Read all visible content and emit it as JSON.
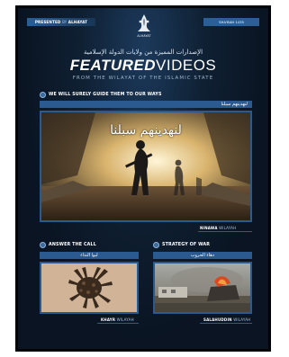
{
  "header": {
    "presented_prefix": "PRESENTED",
    "presented_by": "BY",
    "presented_brand": "ALHAYAT",
    "date": "SHA'BAN 1435",
    "logo_text": "ALHAYAT",
    "arabic_title": "الإصدارات المميزة من ولايات الدولة الإسلامية",
    "title_bold": "FEATURED",
    "title_light": "VIDEOS",
    "subtitle": "FROM THE WILAYAT OF THE ISLAMIC STATE"
  },
  "featured": {
    "section_label": "WE WILL SURELY GUIDE THEM TO OUR WAYS",
    "arabic_title": "لنهدينهم سبلنا",
    "thumb_arabic": "لنهدينهم سبلنا",
    "wilayah_name": "NINAWA",
    "wilayah_word": "WILAYAH"
  },
  "left_video": {
    "section_label": "ANSWER THE CALL",
    "arabic_title": "لبوا النداء",
    "wilayah_name": "KHAYR",
    "wilayah_word": "WILAYAH"
  },
  "right_video": {
    "section_label": "STRATEGY OF WAR",
    "arabic_title": "دهاء الحروب",
    "wilayah_name": "SALAHUDDIN",
    "wilayah_word": "WILAYAH"
  },
  "colors": {
    "page_bg": "#0a1422",
    "accent_blue": "#2a5a90"
  }
}
